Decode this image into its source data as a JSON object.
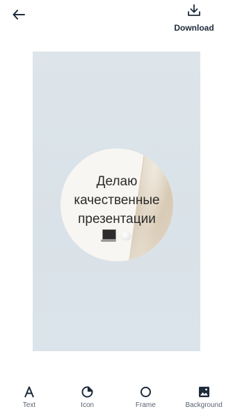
{
  "header": {
    "back_icon": "arrow-left-icon",
    "download_label": "Download",
    "download_icon": "download-tray-icon"
  },
  "canvas": {
    "background_color": "#dbe3e9",
    "circle_color": "#f8f6f2",
    "lines": [
      "Делаю",
      "качественные",
      "презентации"
    ],
    "decor_icons": [
      "laptop-icon",
      "flower-icon"
    ]
  },
  "toolbar": {
    "items": [
      {
        "label": "Text",
        "icon": "text-a-icon"
      },
      {
        "label": "Icon",
        "icon": "sticker-icon"
      },
      {
        "label": "Frame",
        "icon": "circle-frame-icon"
      },
      {
        "label": "Background",
        "icon": "image-icon"
      }
    ]
  },
  "colors": {
    "text_dark": "#1d2a3a",
    "label_gray": "#5a6370"
  }
}
